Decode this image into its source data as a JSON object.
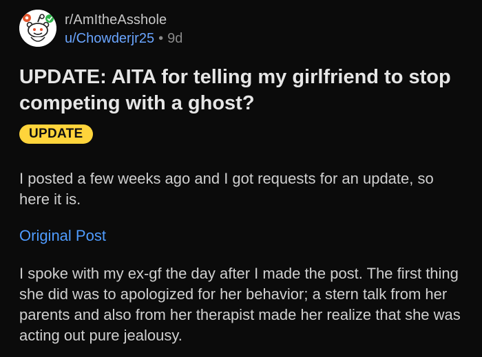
{
  "post": {
    "subreddit": "r/AmItheAsshole",
    "author": "u/Chowderjr25",
    "separator": "•",
    "age": "9d",
    "title": "UPDATE: AITA for telling my girlfriend to stop competing with a ghost?",
    "flair": "UPDATE",
    "body_intro": "I posted a few weeks ago and I got requests for an update, so here it is.",
    "link_label": "Original Post",
    "body_main": "I spoke with my ex-gf the day after I made the post. The first thing she did was to apologized for her behavior; a stern talk from her parents and also from her therapist made her realize that she was acting out pure jealousy."
  },
  "icons": {
    "avatar": "reddit-snoo-avatar-icon"
  },
  "colors": {
    "background": "#0b0b0b",
    "flair": "#ffd43b",
    "link": "#4f9cff",
    "username": "#6aa5ff"
  }
}
